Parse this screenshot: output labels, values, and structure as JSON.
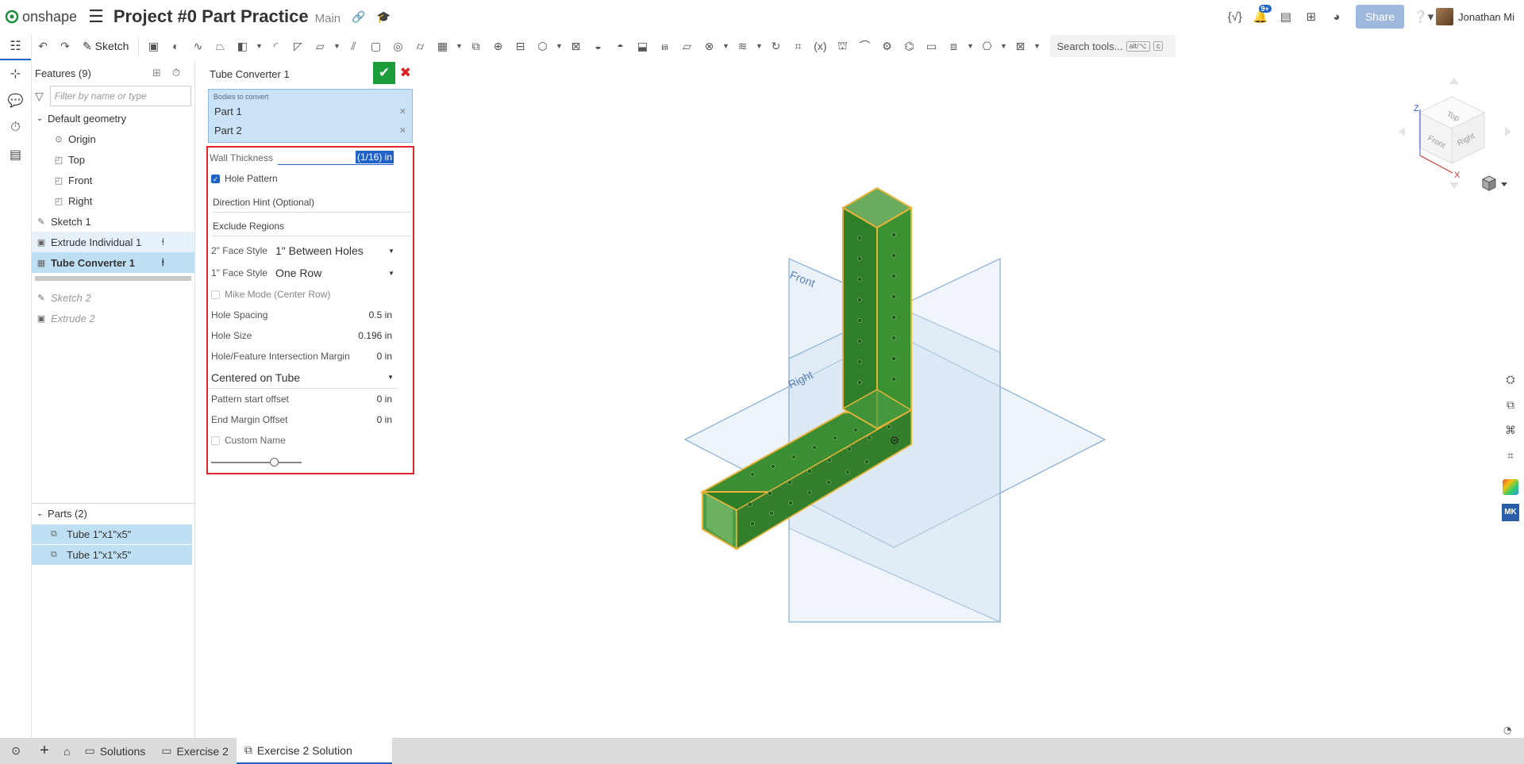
{
  "header": {
    "brand": "onshape",
    "doc_title": "Project #0 Part Practice",
    "branch": "Main",
    "notif_count": "9+",
    "share_label": "Share",
    "user_name": "Jonathan Mi"
  },
  "toolbar": {
    "sketch_label": "Sketch",
    "search_label": "Search tools...",
    "search_kbd1": "alt/⌥",
    "search_kbd2": "c"
  },
  "features": {
    "header": "Features (9)",
    "filter_placeholder": "Filter by name or type",
    "default_geometry": "Default geometry",
    "origin": "Origin",
    "top": "Top",
    "front": "Front",
    "right": "Right",
    "sketch1": "Sketch 1",
    "extrude_individual1": "Extrude Individual 1",
    "tube_converter1": "Tube Converter 1",
    "sketch2": "Sketch 2",
    "extrude2": "Extrude 2",
    "parts_header": "Parts (2)",
    "part1": "Tube 1\"x1\"x5\"",
    "part2": "Tube 1\"x1\"x5\""
  },
  "dialog": {
    "title": "Tube Converter 1",
    "bodies_label": "Bodies to convert",
    "body1": "Part 1",
    "body2": "Part 2",
    "wall_thickness_label": "Wall Thickness",
    "wall_thickness_value": "(1/16) in",
    "hole_pattern_label": "Hole Pattern",
    "direction_hint": "Direction Hint (Optional)",
    "exclude_regions": "Exclude Regions",
    "face2_label": "2\" Face Style",
    "face2_value": "1\" Between Holes",
    "face1_label": "1\" Face Style",
    "face1_value": "One Row",
    "mike_mode": "Mike Mode (Center Row)",
    "hole_spacing_label": "Hole Spacing",
    "hole_spacing_value": "0.5 in",
    "hole_size_label": "Hole Size",
    "hole_size_value": "0.196 in",
    "margin_label": "Hole/Feature Intersection Margin",
    "margin_value": "0 in",
    "centered": "Centered on Tube",
    "start_offset_label": "Pattern start offset",
    "start_offset_value": "0 in",
    "end_margin_label": "End Margin Offset",
    "end_margin_value": "0 in",
    "custom_name": "Custom Name"
  },
  "viewport": {
    "front_plane": "Front",
    "right_plane": "Right",
    "cube_top": "Top",
    "cube_front": "Front",
    "cube_right": "Right",
    "axis_z": "Z",
    "axis_x": "X",
    "right_tool_mk": "MK"
  },
  "tabs": {
    "t1": "Solutions",
    "t2": "Exercise 2",
    "t3": "Exercise 2 Solution"
  }
}
